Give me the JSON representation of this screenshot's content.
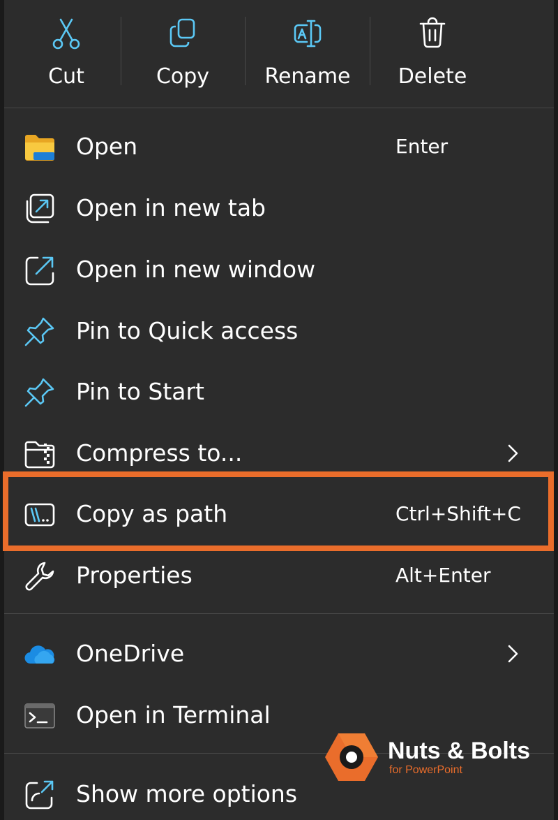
{
  "toolbar": {
    "cut": {
      "label": "Cut",
      "icon": "scissors-icon"
    },
    "copy": {
      "label": "Copy",
      "icon": "copy-icon"
    },
    "rename": {
      "label": "Rename",
      "icon": "rename-icon"
    },
    "delete": {
      "label": "Delete",
      "icon": "trash-icon"
    }
  },
  "items": [
    {
      "label": "Open",
      "shortcut": "Enter",
      "icon": "folder-icon"
    },
    {
      "label": "Open in new tab",
      "icon": "new-tab-icon"
    },
    {
      "label": "Open in new window",
      "icon": "new-window-icon"
    },
    {
      "label": "Pin to Quick access",
      "icon": "pin-icon"
    },
    {
      "label": "Pin to Start",
      "icon": "pin-icon"
    },
    {
      "label": "Compress to...",
      "icon": "zip-folder-icon",
      "submenu": true
    },
    {
      "label": "Copy as path",
      "shortcut": "Ctrl+Shift+C",
      "icon": "copy-path-icon",
      "highlighted": true
    },
    {
      "label": "Properties",
      "shortcut": "Alt+Enter",
      "icon": "wrench-icon"
    },
    {
      "label": "OneDrive",
      "icon": "cloud-icon",
      "submenu": true
    },
    {
      "label": "Open in Terminal",
      "icon": "terminal-icon"
    },
    {
      "label": "Show more options",
      "icon": "share-icon"
    }
  ],
  "watermark": {
    "brand": "Nuts & Bolts",
    "sub": "for PowerPoint"
  },
  "colors": {
    "menu_bg": "#2c2c2c",
    "accent_blue": "#5bc8f5",
    "highlight_border": "#ea6d2b",
    "text": "#ffffff"
  }
}
